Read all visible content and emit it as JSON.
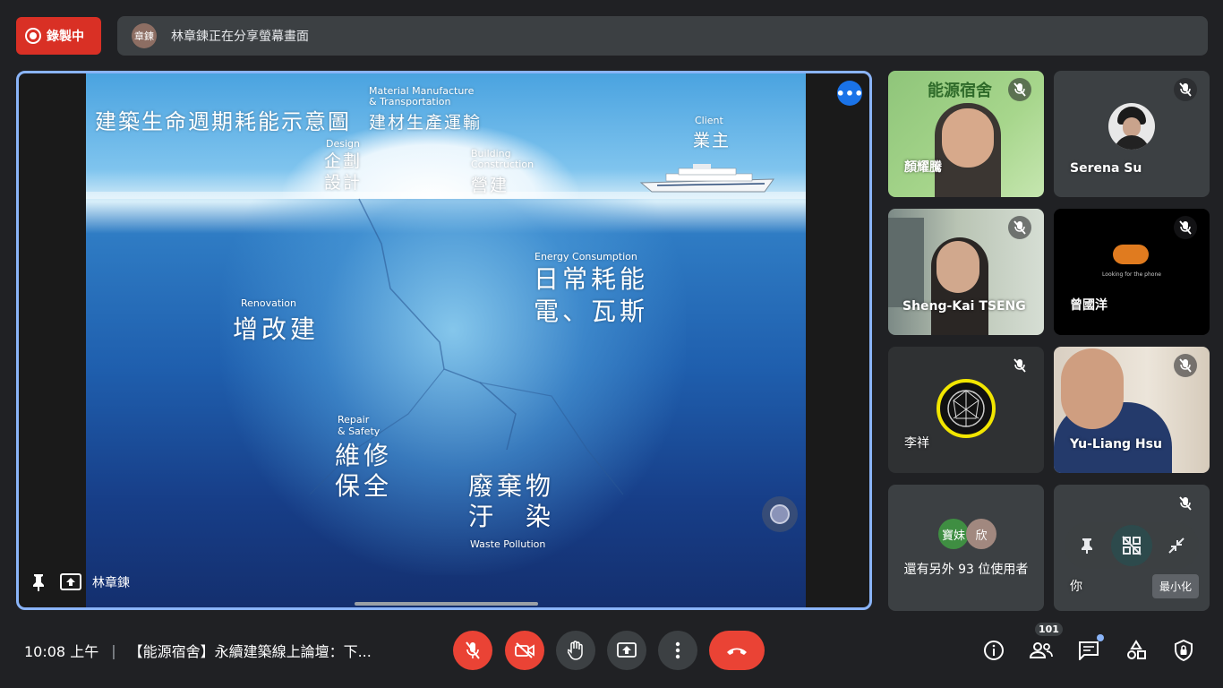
{
  "recording": {
    "label": "錄製中",
    "color": "#d93025"
  },
  "presenter_banner": {
    "avatar_text": "章鍊",
    "text": "林章鍊正在分享螢幕畫面"
  },
  "slide": {
    "title": "建築生命週期耗能示意圖",
    "labels": {
      "material_en": "Material Manufacture\n& Transportation",
      "material_zh": "建材生產運輸",
      "design_en": "Design",
      "design_zh": "企劃\n設計",
      "construction_en": "Building\nConstruction",
      "construction_zh": "營建",
      "client_en": "Client",
      "client_zh": "業主",
      "energy_en": "Energy Consumption",
      "energy_zh": "日常耗能\n電、瓦斯",
      "renovation_en": "Renovation",
      "renovation_zh": "增改建",
      "repair_en": "Repair\n& Safety",
      "repair_zh": "維修\n保全",
      "waste_zh": "廢棄物\n汙　染",
      "waste_en": "Waste Pollution"
    }
  },
  "main_tile": {
    "presenter_name": "林章鍊",
    "accent": "#8ab4f8"
  },
  "participants": [
    {
      "name": "顏耀騰",
      "logo_text": "能源宿舍"
    },
    {
      "name": "Serena Su"
    },
    {
      "name": "Sheng-Kai TSENG"
    },
    {
      "name": "曾國洋",
      "caption": "Looking for the phone"
    },
    {
      "name": "李祥"
    },
    {
      "name": "Yu-Liang Hsu"
    }
  ],
  "others": {
    "avatar1": "寶妹",
    "avatar2": "欣",
    "label": "還有另外 93 位使用者"
  },
  "self": {
    "name": "你",
    "tooltip": "最小化"
  },
  "bottom": {
    "time": "10:08 上午",
    "meeting_title": "【能源宿舍】永續建築線上論壇：下...",
    "people_count": "101"
  }
}
